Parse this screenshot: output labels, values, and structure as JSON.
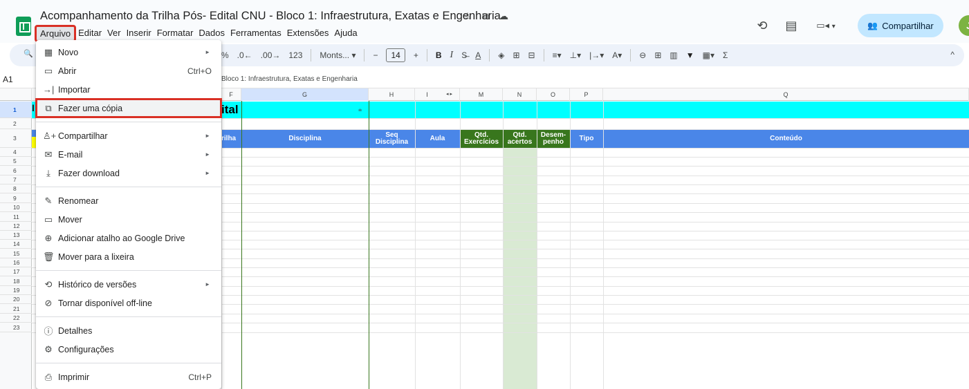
{
  "title_bar": {
    "document_title": "Acompanhamento da Trilha Pós- Edital CNU - Bloco 1: Infraestrutura, Exatas e Engenharia",
    "star_icon": "☆",
    "move_icon": "⧉",
    "cloud_icon": "☁",
    "history_icon": "⟲",
    "comments_icon": "▤",
    "meet_icon": "▭◂",
    "meet_caret": "▾",
    "share_icon": "👥",
    "share_label": "Compartilhar",
    "avatar_letter": "J"
  },
  "menubar": {
    "items": [
      "Arquivo",
      "Editar",
      "Ver",
      "Inserir",
      "Formatar",
      "Dados",
      "Ferramentas",
      "Extensões",
      "Ajuda"
    ],
    "active": "Arquivo"
  },
  "toolbar": {
    "search_icon": "🔍",
    "percent": "%",
    "decimal_decrease": ".0←",
    "decimal_increase": ".00→",
    "number_format": "123",
    "font_name": "Monts...",
    "font_caret": "▾",
    "minus": "−",
    "font_size": "14",
    "plus": "+",
    "bold": "B",
    "italic": "I",
    "strike": "S̶",
    "text_color": "A",
    "fill_color": "◈",
    "borders": "⊞",
    "merge": "⊟",
    "align": "≡▾",
    "valign": "⊥▾",
    "wrap": "|→▾",
    "rotate": "A▾",
    "link": "⊖",
    "comment": "⊞",
    "chart": "▥",
    "filter": "▼",
    "filter_views": "▦▾",
    "functions": "Σ",
    "collapse": "^"
  },
  "formula_bar": {
    "name_box": "A1",
    "content": "Bloco 1: Infraestrutura, Exatas e Engenharia"
  },
  "grid": {
    "columns": [
      {
        "label": "F"
      },
      {
        "label": "G"
      },
      {
        "label": "H"
      },
      {
        "label": "I"
      },
      {
        "label": "◂ ▸"
      },
      {
        "label": "M"
      },
      {
        "label": "N"
      },
      {
        "label": "O"
      },
      {
        "label": "P"
      },
      {
        "label": "Q"
      }
    ],
    "rows": [
      "1",
      "2",
      "3",
      "4",
      "5",
      "6",
      "7",
      "8",
      "9",
      "10",
      "11",
      "12",
      "13",
      "14",
      "15",
      "16",
      "17",
      "18",
      "19",
      "20",
      "21",
      "22",
      "23"
    ],
    "row1_text": "ital",
    "row1_prefix": "I",
    "header_cells": {
      "trilha": "rilha",
      "disciplina": "Disciplina",
      "seq": "Seq Disciplina",
      "aula": "Aula",
      "qtd_exercicios": "Qtd. Exercícios",
      "qtd_acertos": "Qtd. acertos",
      "desempenho": "Desem- penho",
      "tipo": "Tipo",
      "conteudo": "Conteúdo"
    },
    "filter_icon": "⩧"
  },
  "file_menu": {
    "items": [
      {
        "icon": "▦",
        "label": "Novo",
        "shortcut": "",
        "submenu": true
      },
      {
        "icon": "▭",
        "label": "Abrir",
        "shortcut": "Ctrl+O",
        "submenu": false
      },
      {
        "icon": "→|",
        "label": "Importar",
        "shortcut": "",
        "submenu": false
      },
      {
        "icon": "⧉",
        "label": "Fazer uma cópia",
        "shortcut": "",
        "submenu": false,
        "highlighted": true
      },
      {
        "icon": "♙+",
        "label": "Compartilhar",
        "shortcut": "",
        "submenu": true
      },
      {
        "icon": "✉",
        "label": "E-mail",
        "shortcut": "",
        "submenu": true
      },
      {
        "icon": "⤓",
        "label": "Fazer download",
        "shortcut": "",
        "submenu": true
      },
      {
        "icon": "✎",
        "label": "Renomear",
        "shortcut": "",
        "submenu": false
      },
      {
        "icon": "▭",
        "label": "Mover",
        "shortcut": "",
        "submenu": false
      },
      {
        "icon": "⊕",
        "label": "Adicionar atalho ao Google Drive",
        "shortcut": "",
        "submenu": false
      },
      {
        "icon": "🗑",
        "label": "Mover para a lixeira",
        "shortcut": "",
        "submenu": false
      },
      {
        "icon": "⟲",
        "label": "Histórico de versões",
        "shortcut": "",
        "submenu": true
      },
      {
        "icon": "⊘",
        "label": "Tornar disponível off-line",
        "shortcut": "",
        "submenu": false
      },
      {
        "icon": "ⓘ",
        "label": "Detalhes",
        "shortcut": "",
        "submenu": false
      },
      {
        "icon": "⚙",
        "label": "Configurações",
        "shortcut": "",
        "submenu": false
      },
      {
        "icon": "⎙",
        "label": "Imprimir",
        "shortcut": "Ctrl+P",
        "submenu": false
      }
    ],
    "submenu_arrow": "►"
  },
  "colors": {
    "accent_red": "#d93025",
    "header_blue": "#4a86e8",
    "header_green": "#38761d",
    "cyan": "#00ffff",
    "share_bg": "#c2e7ff"
  }
}
